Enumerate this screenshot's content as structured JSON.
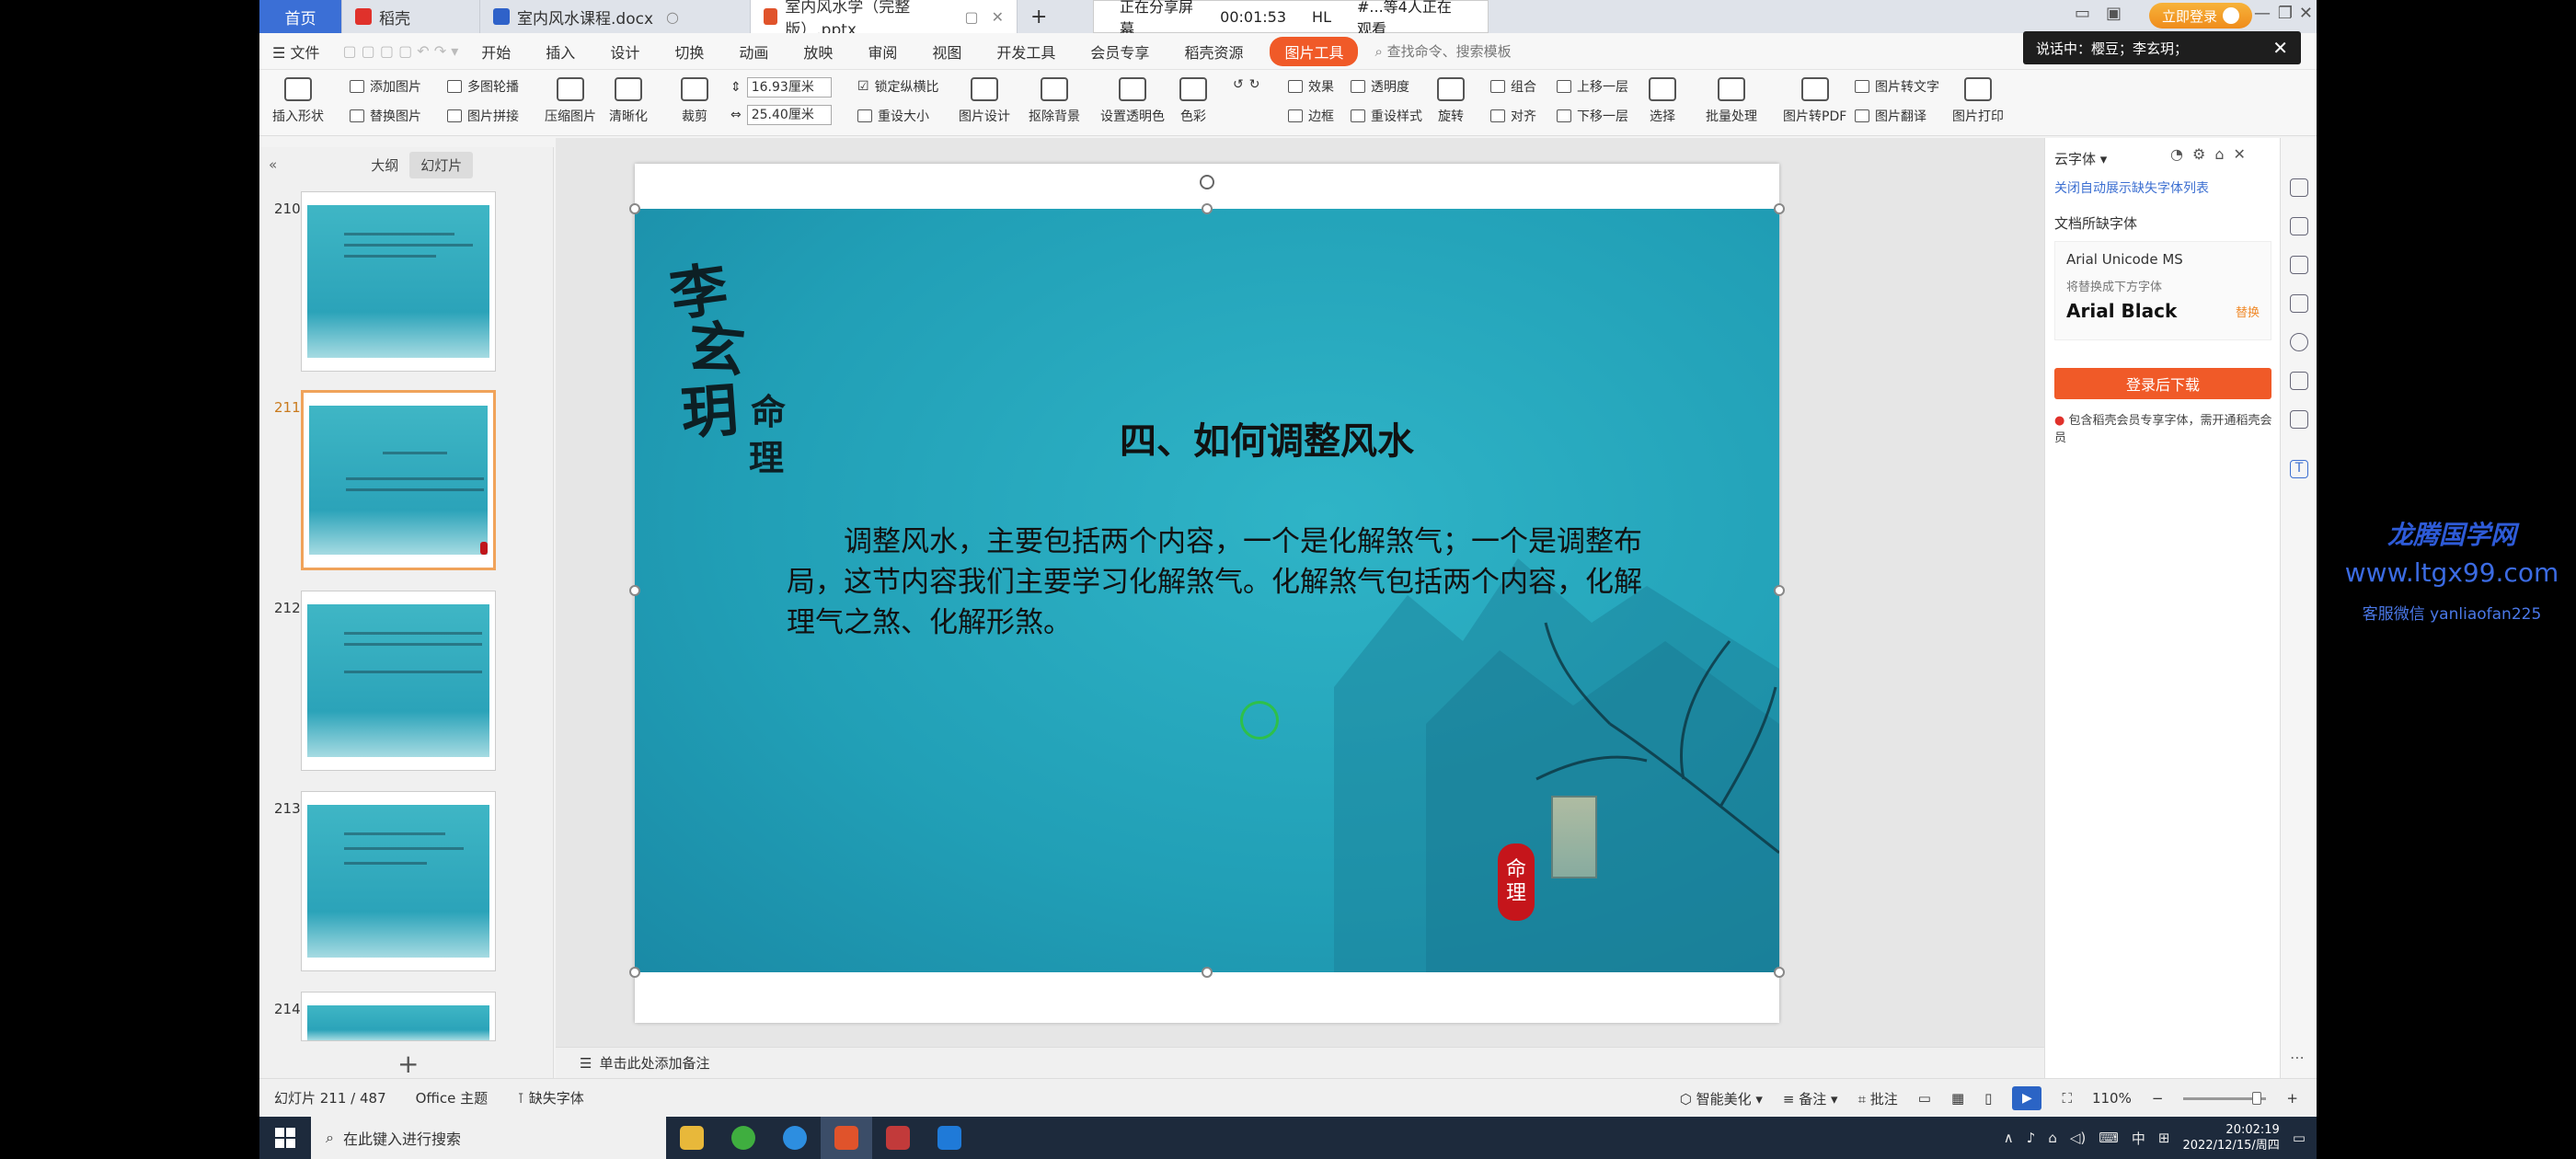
{
  "tabs": [
    {
      "label": "首页",
      "kind": "home"
    },
    {
      "label": "稻壳",
      "icon": "docer-icon"
    },
    {
      "label": "室内风水课程.docx",
      "icon": "word-icon"
    },
    {
      "label": "室内风水学（完整版）.pptx",
      "icon": "ppt-icon",
      "active": true
    }
  ],
  "share_bar": {
    "status": "正在分享屏幕",
    "timer": "00:01:53",
    "host": "HL",
    "viewers": "#...等4人正在观看"
  },
  "login_button": "立即登录",
  "call_notice": {
    "text": "说话中：樱豆；李玄玥；"
  },
  "menu": {
    "file": "文件",
    "items": [
      "开始",
      "插入",
      "设计",
      "切换",
      "动画",
      "放映",
      "审阅",
      "视图",
      "开发工具",
      "会员专享",
      "稻壳资源"
    ],
    "picture_tools": "图片工具",
    "search_placeholder": "查找命令、搜索模板"
  },
  "ribbon": {
    "insert_shape": "插入形状",
    "add_picture": "添加图片",
    "replace_picture": "替换图片",
    "multi_outline": "多图轮播",
    "picture_concat": "图片拼接",
    "compress": "压缩图片",
    "sharpen": "清晰化",
    "crop": "裁剪",
    "height": "16.93厘米",
    "width": "25.40厘米",
    "lock_ratio": "锁定纵横比",
    "reset_size": "重设大小",
    "pic_design": "图片设计",
    "remove_bg": "抠除背景",
    "set_transparent": "设置透明色",
    "color": "色彩",
    "effects": "效果",
    "border": "边框",
    "transparency": "透明度",
    "reset_style": "重设样式",
    "rotate": "旋转",
    "align": "对齐",
    "group": "组合",
    "bring_forward": "上移一层",
    "send_backward": "下移一层",
    "select": "选择",
    "batch": "批量处理",
    "to_pdf": "图片转PDF",
    "to_text": "图片转文字",
    "translate": "图片翻译",
    "print": "图片打印"
  },
  "left_panel": {
    "tab_outline": "大纲",
    "tab_slides": "幻灯片",
    "thumbs": [
      {
        "num": "210"
      },
      {
        "num": "211",
        "selected": true
      },
      {
        "num": "212"
      },
      {
        "num": "213"
      },
      {
        "num": "214"
      }
    ]
  },
  "slide": {
    "title": "四、如何调整风水",
    "body": "调整风水，主要包括两个内容，一个是化解煞气；一个是调整布局，这节内容我们主要学习化解煞气。化解煞气包括两个内容，化解理气之煞、化解形煞。",
    "calligraphy": [
      "李",
      "玄",
      "玥",
      "命",
      "理"
    ],
    "seal_text": [
      "命",
      "理"
    ]
  },
  "notes_placeholder": "单击此处添加备注",
  "right_panel": {
    "title": "云字体",
    "close_link": "关闭自动展示缺失字体列表",
    "missing_label": "文档所缺字体",
    "missing_font": "Arial Unicode MS",
    "replace_hint": "将替换成下方字体",
    "replacement": "Arial Black",
    "replace_action": "替换",
    "download": "登录后下载",
    "note": "包含稻壳会员专享字体，需开通稻壳会员"
  },
  "status": {
    "slide_pos": "幻灯片 211 / 487",
    "theme": "Office 主题",
    "missing_fonts": "缺失字体",
    "smart_beautify": "智能美化",
    "notes": "备注",
    "comments": "批注",
    "zoom": "110%"
  },
  "taskbar": {
    "search_placeholder": "在此键入进行搜索",
    "time": "20:02:19",
    "date": "2022/12/15/周四",
    "ime": "中"
  },
  "watermark": {
    "name": "龙腾国学网",
    "url": "www.ltgx99.com",
    "contact": "客服微信 yanliaofan225"
  },
  "colors": {
    "accent": "#f05a28",
    "brand": "#3b6fd6",
    "slide_bg": "#219fb6"
  }
}
